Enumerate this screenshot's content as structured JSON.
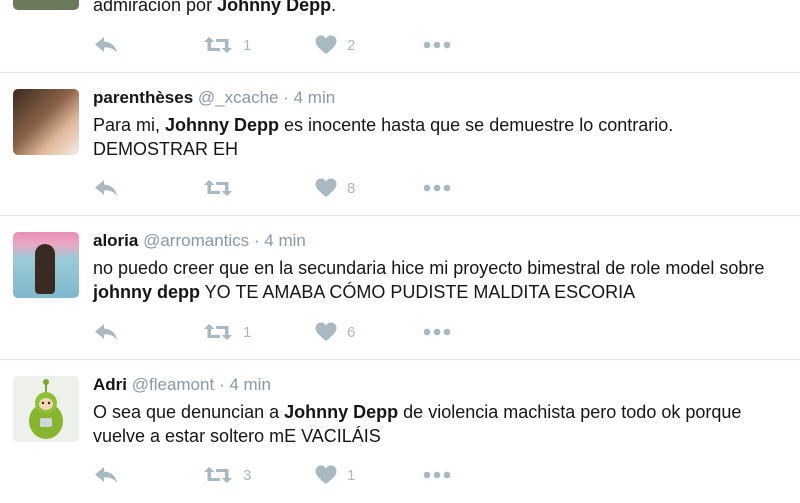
{
  "tweets": [
    {
      "name": "",
      "handle": "",
      "time": "",
      "text_parts": [
        "admiración por ",
        "Johnny Depp",
        "."
      ],
      "retweets": "1",
      "likes": "2"
    },
    {
      "name": "parenthèses",
      "handle": "@_xcache",
      "time": "4 min",
      "text_parts": [
        "Para mi, ",
        "Johnny Depp",
        " es inocente hasta que se demuestre lo contrario. DEMOSTRAR EH"
      ],
      "retweets": "",
      "likes": "8"
    },
    {
      "name": "aloria",
      "handle": "@arromantics",
      "time": "4 min",
      "text_parts": [
        "no puedo creer que en la secundaria hice mi proyecto bimestral de role model sobre ",
        "johnny depp",
        " YO TE AMABA CÓMO PUDISTE MALDITA ESCORIA"
      ],
      "retweets": "1",
      "likes": "6"
    },
    {
      "name": "Adri",
      "handle": "@fleamont",
      "time": "4 min",
      "text_parts": [
        "O sea que denuncian a ",
        "Johnny Depp",
        " de violencia machista pero todo ok porque vuelve a estar soltero mE VACILÁIS"
      ],
      "retweets": "3",
      "likes": "1"
    }
  ],
  "separator": "·",
  "icons": {
    "reply": "reply-icon",
    "retweet": "retweet-icon",
    "like": "heart-icon",
    "more": "more-dots-icon"
  }
}
